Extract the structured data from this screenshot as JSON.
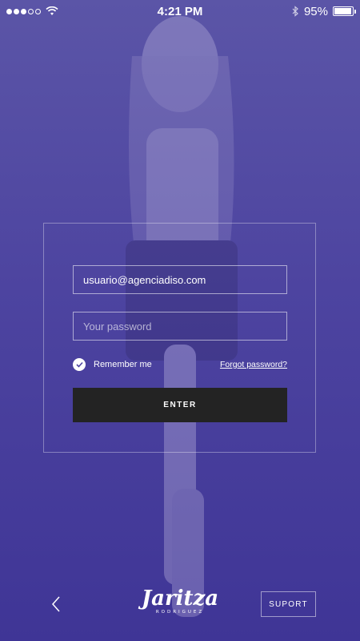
{
  "status_bar": {
    "time": "4:21 PM",
    "battery_percent": "95%",
    "battery_level": 0.95,
    "signal_bars_filled": 3,
    "signal_bars_total": 5
  },
  "login": {
    "email_value": "usuario@agenciadiso.com",
    "password_placeholder": "Your password",
    "remember_label": "Remember me",
    "remember_checked": true,
    "forgot_label": "Forgot password?",
    "enter_label": "ENTER"
  },
  "footer": {
    "brand_name": "Jaritza",
    "brand_subtitle": "RODRIGUEZ",
    "support_label": "SUPORT"
  },
  "colors": {
    "background_top": "#5b55a7",
    "background_bottom": "#3f3596",
    "button_dark": "#232323"
  }
}
